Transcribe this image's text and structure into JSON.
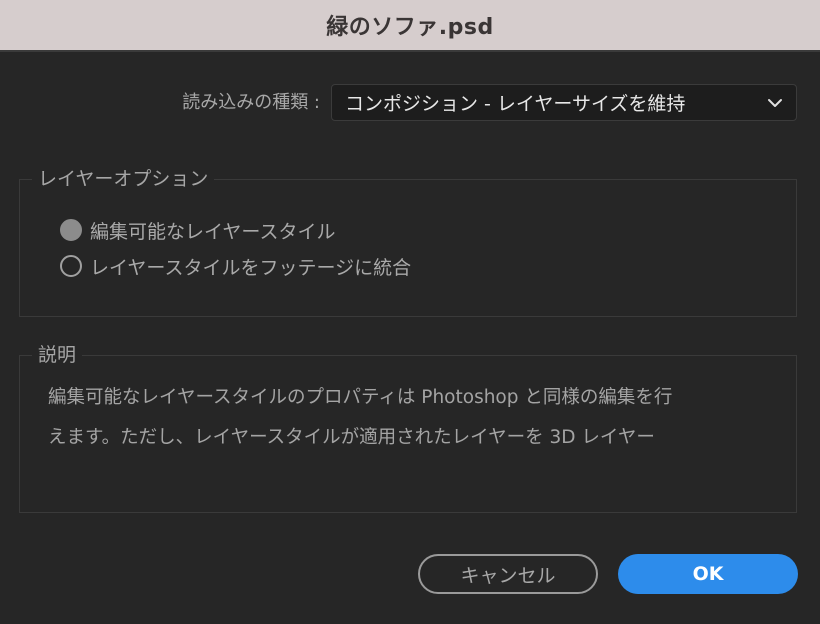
{
  "window": {
    "title": "緑のソファ.psd"
  },
  "import": {
    "label": "読み込みの種類 :",
    "selected_value": "コンポジション - レイヤーサイズを維持"
  },
  "layer_options": {
    "legend": "レイヤーオプション",
    "options": [
      {
        "label": "編集可能なレイヤースタイル",
        "selected": true
      },
      {
        "label": "レイヤースタイルをフッテージに統合",
        "selected": false
      }
    ]
  },
  "description": {
    "legend": "説明",
    "line1": "編集可能なレイヤースタイルのプロパティは Photoshop と同様の編集を行",
    "line2": "えます。ただし、レイヤースタイルが適用されたレイヤーを 3D レイヤー"
  },
  "buttons": {
    "cancel_label": "キャンセル",
    "ok_label": "OK"
  },
  "colors": {
    "accent": "#2d8ceb",
    "background": "#262626",
    "titlebar": "#d6cdcd"
  },
  "icons": {
    "dropdown": "chevron-down-icon"
  }
}
